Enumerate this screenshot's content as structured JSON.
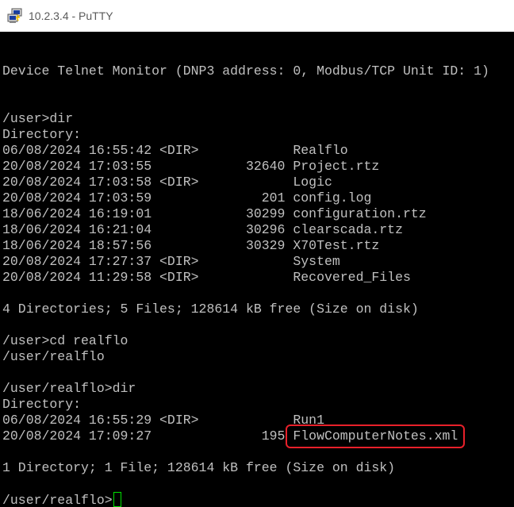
{
  "window": {
    "title": "10.2.3.4 - PuTTY",
    "icon": "putty-computers-icon"
  },
  "terminal": {
    "colors": {
      "background": "#000000",
      "foreground": "#c0c0c0",
      "cursor": "#00e000",
      "highlight": "#e8202a"
    },
    "lines": [
      "",
      "Device Telnet Monitor (DNP3 address: 0, Modbus/TCP Unit ID: 1)",
      "",
      "",
      "/user>dir",
      "Directory:",
      "06/08/2024 16:55:42 <DIR>            Realflo",
      "20/08/2024 17:03:55            32640 Project.rtz",
      "20/08/2024 17:03:58 <DIR>            Logic",
      "20/08/2024 17:03:59              201 config.log",
      "18/06/2024 16:19:01            30299 configuration.rtz",
      "18/06/2024 16:21:04            30296 clearscada.rtz",
      "18/06/2024 18:57:56            30329 X70Test.rtz",
      "20/08/2024 17:27:37 <DIR>            System",
      "20/08/2024 11:29:58 <DIR>            Recovered_Files",
      "",
      "4 Directories; 5 Files; 128614 kB free (Size on disk)",
      "",
      "/user>cd realflo",
      "/user/realflo",
      "",
      "/user/realflo>dir",
      "Directory:",
      "06/08/2024 16:55:29 <DIR>            Run1",
      "20/08/2024 17:09:27              195 ",
      "",
      "1 Directory; 1 File; 128614 kB free (Size on disk)",
      "",
      "/user/realflo>"
    ],
    "highlighted_filename": "FlowComputerNotes.xml"
  }
}
